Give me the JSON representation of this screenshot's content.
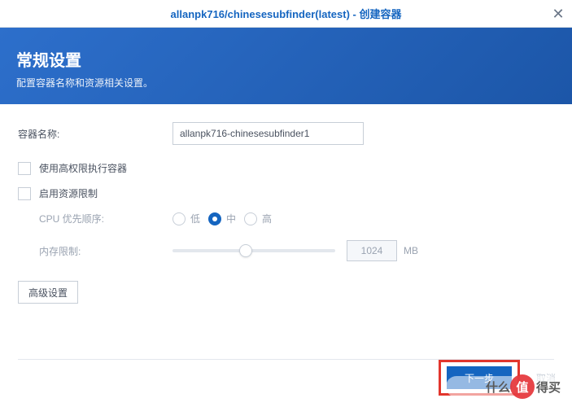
{
  "titlebar": {
    "text": "allanpk716/chinesesubfinder(latest) - 创建容器"
  },
  "hero": {
    "title": "常规设置",
    "subtitle": "配置容器名称和资源相关设置。"
  },
  "form": {
    "container_name_label": "容器名称:",
    "container_name_value": "allanpk716-chinesesubfinder1",
    "high_privilege_label": "使用高权限执行容器",
    "enable_limit_label": "启用资源限制",
    "cpu_label": "CPU 优先顺序:",
    "cpu_options": {
      "low": "低",
      "mid": "中",
      "high": "高"
    },
    "mem_label": "内存限制:",
    "mem_value": "1024",
    "mem_unit": "MB",
    "advanced_label": "高级设置"
  },
  "footer": {
    "next": "下一步",
    "cancel": "取消"
  },
  "watermark": {
    "char": "值",
    "text1": "什么",
    "text2": "得买"
  }
}
